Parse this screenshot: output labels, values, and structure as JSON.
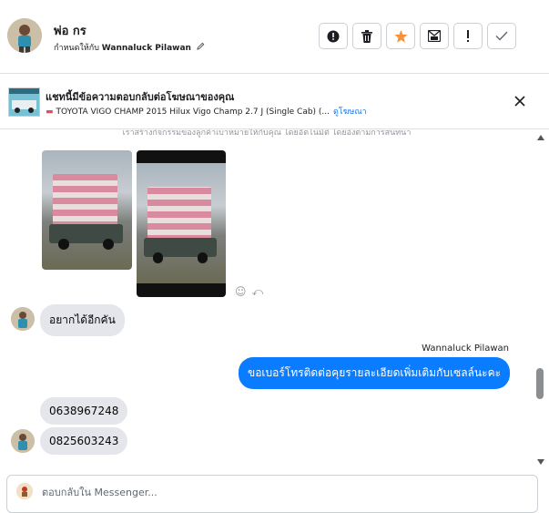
{
  "header": {
    "name": "พ่อ กร",
    "assigned_prefix": "กำหนดให้กับ",
    "assigned_to": "Wannaluck Pilawan",
    "edit_icon": "pencil-icon",
    "actions": [
      "alert-circle-icon",
      "trash-icon",
      "star-icon",
      "mark-spam-icon",
      "exclamation-icon",
      "check-icon"
    ],
    "star_color": "#f7923b"
  },
  "ad_bar": {
    "title": "แชทนี้มีข้อความตอบกลับต่อโฆษณาของคุณ",
    "subtitle": "TOYOTA VIGO CHAMP 2015 Hilux Vigo Champ 2.7 J (Single Cab) (...",
    "link": "ดูโฆษณา",
    "car_icon": "car-icon",
    "close_icon": "close-icon"
  },
  "thread": {
    "notice": "เราสร้างกิจกรรมของลูกค้าเบาหมายให้กับคุณ โดยอัตโนมัติ โดยอิงตามการสนทนา",
    "messages": {
      "m1": "อยากได้อีกคัน",
      "sender": "Wannaluck Pilawan",
      "out1": "ขอเบอร์โทรติดต่อคุยรายละเอียดเพิ่มเติมกับเซลล์นะคะ",
      "m2": "0638967248",
      "m3": "0825603243"
    },
    "accent_color": "#0a7cff"
  },
  "composer": {
    "placeholder": "ตอบกลับใน Messenger..."
  }
}
